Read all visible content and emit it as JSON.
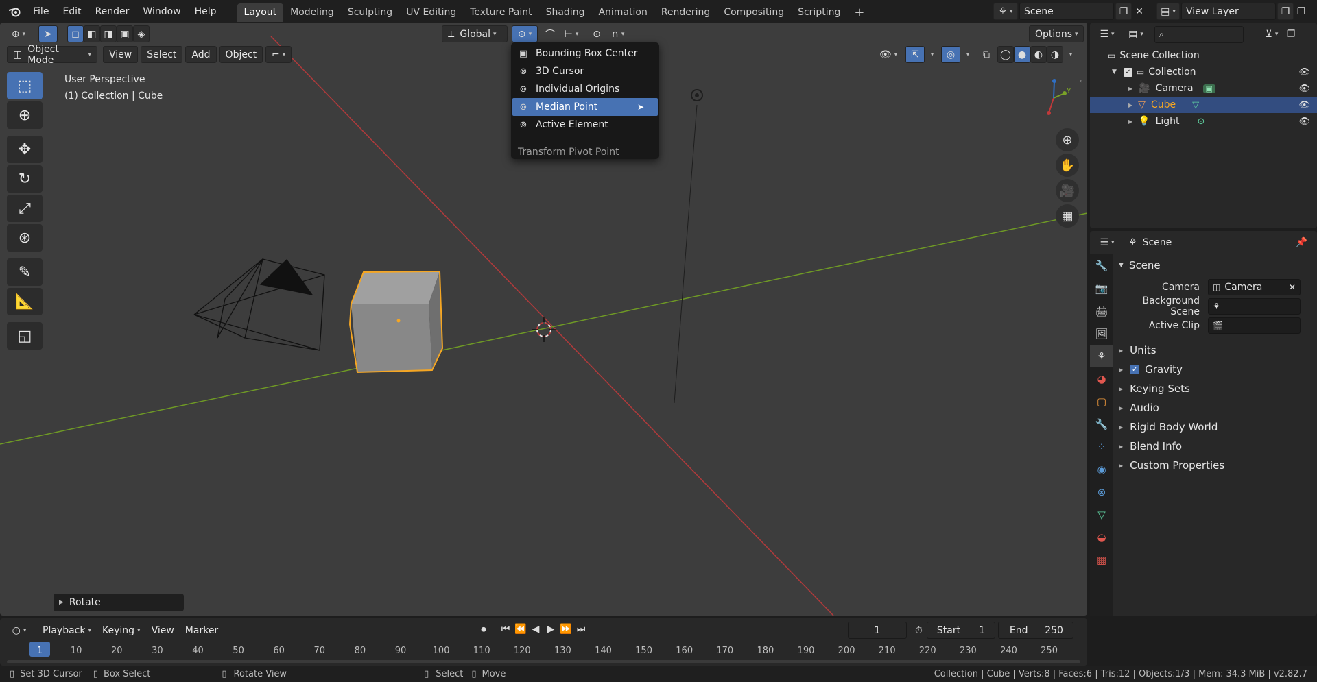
{
  "topbar": {
    "menus": [
      "File",
      "Edit",
      "Render",
      "Window",
      "Help"
    ],
    "workspaces": [
      "Layout",
      "Modeling",
      "Sculpting",
      "UV Editing",
      "Texture Paint",
      "Shading",
      "Animation",
      "Rendering",
      "Compositing",
      "Scripting"
    ],
    "active_workspace": "Layout",
    "add_tab": "+",
    "scene_name": "Scene",
    "view_layer": "View Layer"
  },
  "viewport_header": {
    "mode": "Object Mode",
    "menus": [
      "View",
      "Select",
      "Add",
      "Object"
    ],
    "orientation": "Global",
    "options": "Options"
  },
  "overlay_text": {
    "view_name": "User Perspective",
    "collection_info": "(1) Collection | Cube"
  },
  "dropdown": {
    "items": [
      {
        "label": "Bounding Box Center",
        "icon": "bounding-box-icon"
      },
      {
        "label": "3D Cursor",
        "icon": "cursor-icon"
      },
      {
        "label": "Individual Origins",
        "icon": "origins-icon"
      },
      {
        "label": "Median Point",
        "icon": "median-icon"
      },
      {
        "label": "Active Element",
        "icon": "active-element-icon"
      }
    ],
    "active_index": 3,
    "title": "Transform Pivot Point"
  },
  "last_operator": "Rotate",
  "outliner": {
    "root": "Scene Collection",
    "collection": "Collection",
    "objects": [
      {
        "name": "Camera",
        "color": "#e59a5a"
      },
      {
        "name": "Cube",
        "color": "#e59a5a"
      },
      {
        "name": "Light",
        "color": "#e59a5a"
      }
    ],
    "selected": "Cube"
  },
  "properties": {
    "context": "Scene",
    "panel": "Scene",
    "camera_label": "Camera",
    "camera_value": "Camera",
    "background_scene_label": "Background Scene",
    "active_clip_label": "Active Clip",
    "subpanels": [
      "Units",
      "Gravity",
      "Keying Sets",
      "Audio",
      "Rigid Body World",
      "Blend Info",
      "Custom Properties"
    ],
    "gravity_checked": true
  },
  "timeline": {
    "menus": [
      "Playback",
      "Keying",
      "View",
      "Marker"
    ],
    "current_frame": "1",
    "start_label": "Start",
    "start": "1",
    "end_label": "End",
    "end": "250",
    "ticks": [
      "1",
      "10",
      "20",
      "30",
      "40",
      "50",
      "60",
      "70",
      "80",
      "90",
      "100",
      "110",
      "120",
      "130",
      "140",
      "150",
      "160",
      "170",
      "180",
      "190",
      "200",
      "210",
      "220",
      "230",
      "240",
      "250"
    ]
  },
  "statusbar": {
    "hints": [
      "Set 3D Cursor",
      "Box Select",
      "Rotate View",
      "Select",
      "Move"
    ],
    "stats": "Collection | Cube | Verts:8 | Faces:6 | Tris:12 | Objects:1/3 | Mem: 34.3 MiB | v2.82.7"
  },
  "colors": {
    "accent": "#4772b3",
    "selection_orange": "#f5a623",
    "x_axis": "#c0393a",
    "y_axis": "#7aa227"
  }
}
